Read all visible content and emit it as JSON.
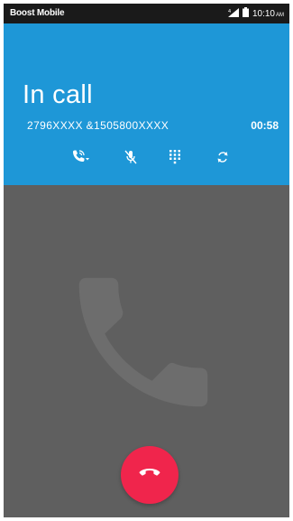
{
  "status_bar": {
    "carrier": "Boost Mobile",
    "time": "10:10",
    "ampm": "AM"
  },
  "call": {
    "title": "In call",
    "numbers": "2796XXXX &1505800XXXX",
    "timer": "00:58"
  },
  "controls": [
    {
      "name": "call-options",
      "icon": "phone-options-icon"
    },
    {
      "name": "mute",
      "icon": "mic-off-icon"
    },
    {
      "name": "dialpad",
      "icon": "dialpad-icon"
    },
    {
      "name": "swap",
      "icon": "swap-icon"
    }
  ],
  "colors": {
    "header": "#1e97d7",
    "background": "#5f5f5f",
    "end_call": "#f0254c"
  }
}
